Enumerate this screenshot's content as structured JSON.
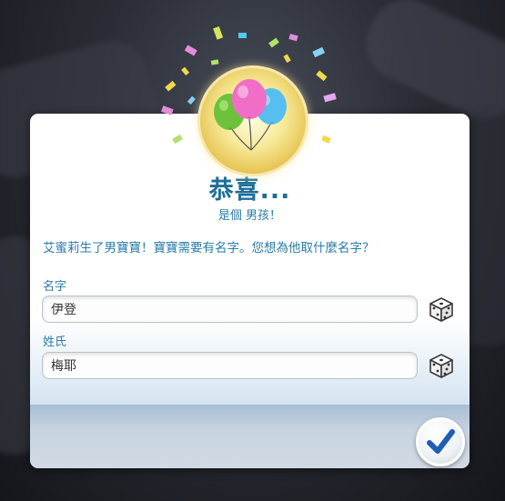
{
  "dialog": {
    "title": "恭喜...",
    "subtitle": "是個 男孩！",
    "message": "艾蜜莉生了男寶寶！寶寶需要有名字。您想為他取什麼名字？",
    "first_name": {
      "label": "名字",
      "value": "伊登"
    },
    "last_name": {
      "label": "姓氏",
      "value": "梅耶"
    }
  },
  "icons": {
    "celebration": "balloons-icon",
    "randomize": "dice-icon",
    "confirm": "checkmark-icon"
  },
  "colors": {
    "accent_blue": "#1d6e99",
    "text_blue": "#2a7ba8",
    "check_blue": "#1e5fb3",
    "medal_gold": "#e5c24e"
  }
}
